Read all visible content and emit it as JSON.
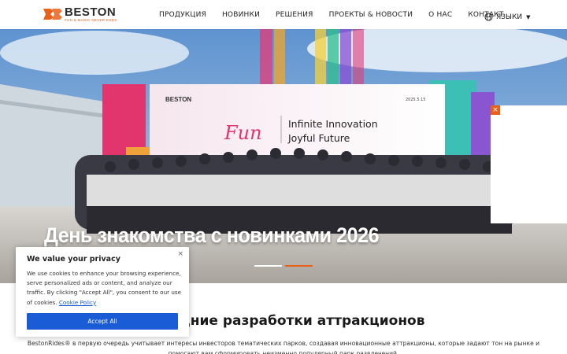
{
  "header": {
    "logo_name": "BESTON",
    "logo_tagline": "FUN & MAGIC NEVER ENDS",
    "nav": [
      "ПРОДУКЦИЯ",
      "НОВИНКИ",
      "РЕШЕНИЯ",
      "ПРОЕКТЫ & НОВОСТИ",
      "О НАС",
      "КОНТАКТ"
    ],
    "language_label": "ЯЗЫКИ"
  },
  "hero": {
    "title": "День знакомства с новинками 2026",
    "banner_brand": "BESTON",
    "banner_script": "Fun",
    "banner_line1": "Infinite Innovation",
    "banner_line2": "Joyful Future",
    "banner_date": "2025.5.15",
    "slides_count": 2,
    "active_slide": 2
  },
  "section": {
    "title_visible": "дние разработки аттракционов",
    "text": "BestonRides® в первую очередь учитывает интересы инвесторов тематических парков, создавая инновационные аттракционы, которые задают тон на рынке и помогают вам сформировать неизменно популярный парк развлечений."
  },
  "cookie": {
    "title": "We value your privacy",
    "body": "We use cookies to enhance your browsing experience, serve personalized ads or content, and analyze our traffic. By clicking \"Accept All\", you consent to our use of cookies.",
    "link": "Cookie Policy",
    "accept_label": "Accept All",
    "close_glyph": "×"
  },
  "popup": {
    "close_glyph": "×"
  },
  "colors": {
    "brand_orange": "#e8611a",
    "button_blue": "#1a5bd6"
  }
}
